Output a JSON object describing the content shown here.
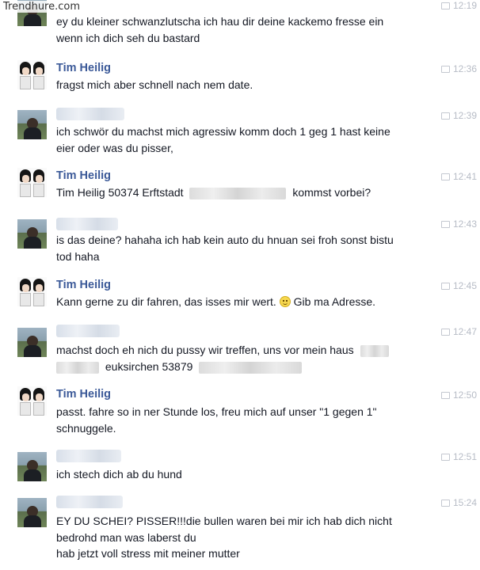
{
  "watermark": "Trendhure.com",
  "messages": [
    {
      "sender": "",
      "time": "12:19",
      "lines": [
        "ey du kleiner schwanzlutscha ich hau dir deine kackemo fresse ein",
        "wenn ich dich seh du bastard"
      ]
    },
    {
      "sender": "Tim Heilig",
      "time": "12:36",
      "lines": [
        "fragst mich aber schnell nach nem date."
      ]
    },
    {
      "sender": "",
      "time": "12:39",
      "lines": [
        "ich schwör du machst mich agressiw komm doch 1 geg 1 hast keine",
        "eier oder was du pisser,"
      ]
    },
    {
      "sender": "Tim Heilig",
      "time": "12:41",
      "parts": [
        "Tim Heilig 50374 Erftstadt",
        "kommst vorbei?"
      ]
    },
    {
      "sender": "",
      "time": "12:43",
      "lines": [
        "is das deine? hahaha ich hab kein auto du hnuan sei froh sonst bistu",
        "tod haha"
      ]
    },
    {
      "sender": "Tim Heilig",
      "time": "12:45",
      "parts": [
        "Kann gerne zu dir fahren, das isses mir wert.",
        "Gib ma Adresse."
      ]
    },
    {
      "sender": "",
      "time": "12:47",
      "parts": [
        "machst doch eh nich du pussy wir treffen, uns vor mein haus",
        "euksirchen 53879"
      ]
    },
    {
      "sender": "Tim Heilig",
      "time": "12:50",
      "lines": [
        "passt. fahre so in ner Stunde los, freu mich auf unser \"1 gegen 1\"",
        "schnuggele."
      ]
    },
    {
      "sender": "",
      "time": "12:51",
      "lines": [
        "ich stech dich ab du hund"
      ]
    },
    {
      "sender": "",
      "time": "15:24",
      "lines": [
        "EY DU SCHEI? PISSER!!!die bullen waren bei mir ich hab dich nicht",
        "bedrohd man was laberst du",
        "hab jetzt voll stress mit meiner mutter"
      ]
    }
  ]
}
